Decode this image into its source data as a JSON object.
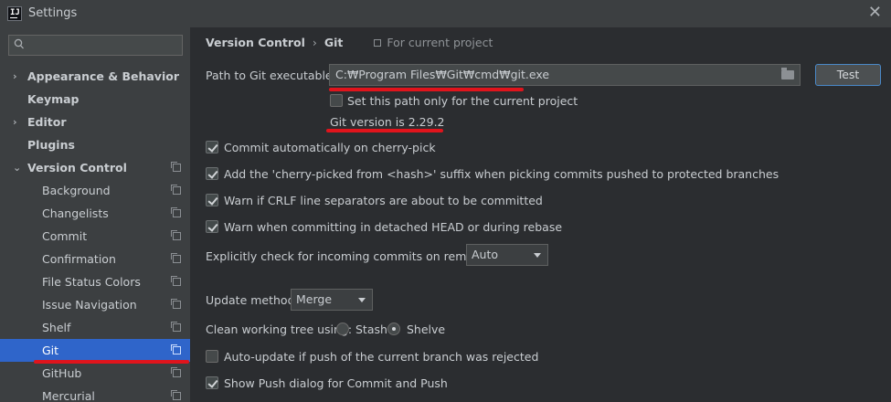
{
  "window": {
    "title": "Settings",
    "logo_text": "IJ"
  },
  "search": {
    "placeholder": ""
  },
  "sidebar": {
    "items": [
      {
        "label": "Appearance & Behavior",
        "arrow": "›"
      },
      {
        "label": "Keymap"
      },
      {
        "label": "Editor",
        "arrow": "›"
      },
      {
        "label": "Plugins"
      },
      {
        "label": "Version Control",
        "arrow": "⌄"
      },
      {
        "label": "Background"
      },
      {
        "label": "Changelists"
      },
      {
        "label": "Commit"
      },
      {
        "label": "Confirmation"
      },
      {
        "label": "File Status Colors"
      },
      {
        "label": "Issue Navigation"
      },
      {
        "label": "Shelf"
      },
      {
        "label": "Git"
      },
      {
        "label": "GitHub"
      },
      {
        "label": "Mercurial"
      }
    ],
    "selected": "Git"
  },
  "breadcrumb": {
    "parent": "Version Control",
    "separator": "›",
    "current": "Git",
    "scope": "For current project"
  },
  "git": {
    "path_label": "Path to Git executable:",
    "path_value": "C:₩Program Files₩Git₩cmd₩git.exe",
    "test_button": "Test",
    "set_path_only": "Set this path only for the current project",
    "version_text": "Git version is 2.29.2"
  },
  "options": {
    "commit_cherry_pick": "Commit automatically on cherry-pick",
    "cherry_picked_suffix": "Add the 'cherry-picked from <hash>' suffix when picking commits pushed to protected branches",
    "warn_crlf": "Warn if CRLF line separators are about to be committed",
    "warn_detached": "Warn when committing in detached HEAD or during rebase",
    "incoming_label": "Explicitly check for incoming commits on remotes:",
    "incoming_value": "Auto",
    "update_method_label": "Update method:",
    "update_method_value": "Merge",
    "clean_tree_label": "Clean working tree using:",
    "stash_label": "Stash",
    "shelve_label": "Shelve",
    "auto_update": "Auto-update if push of the current branch was rejected",
    "show_push_dialog": "Show Push dialog for Commit and Push"
  },
  "colors": {
    "selection": "#2f65ca",
    "annotation": "#e0141c",
    "accent_border": "#4a88c7"
  }
}
